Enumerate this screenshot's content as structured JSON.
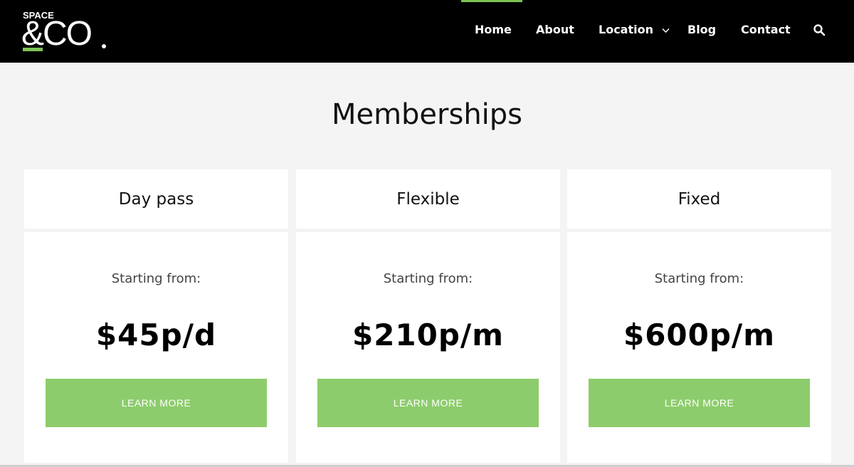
{
  "brand": {
    "logo_small": "SPACE",
    "logo_big": "&CO",
    "accent_color": "#7dc356",
    "button_color": "#8dcc6c"
  },
  "nav": {
    "items": [
      {
        "label": "Home",
        "active": true
      },
      {
        "label": "About"
      },
      {
        "label": "Location",
        "has_dropdown": true
      },
      {
        "label": "Blog"
      },
      {
        "label": "Contact"
      }
    ],
    "search_icon": "search-icon"
  },
  "main": {
    "title": "Memberships",
    "plans": [
      {
        "name": "Day pass",
        "starting_label": "Starting from:",
        "price": "$45p/d",
        "button": "LEARN MORE"
      },
      {
        "name": "Flexible",
        "starting_label": "Starting from:",
        "price": "$210p/m",
        "button": "LEARN MORE"
      },
      {
        "name": "Fixed",
        "starting_label": "Starting from:",
        "price": "$600p/m",
        "button": "LEARN MORE"
      }
    ]
  }
}
